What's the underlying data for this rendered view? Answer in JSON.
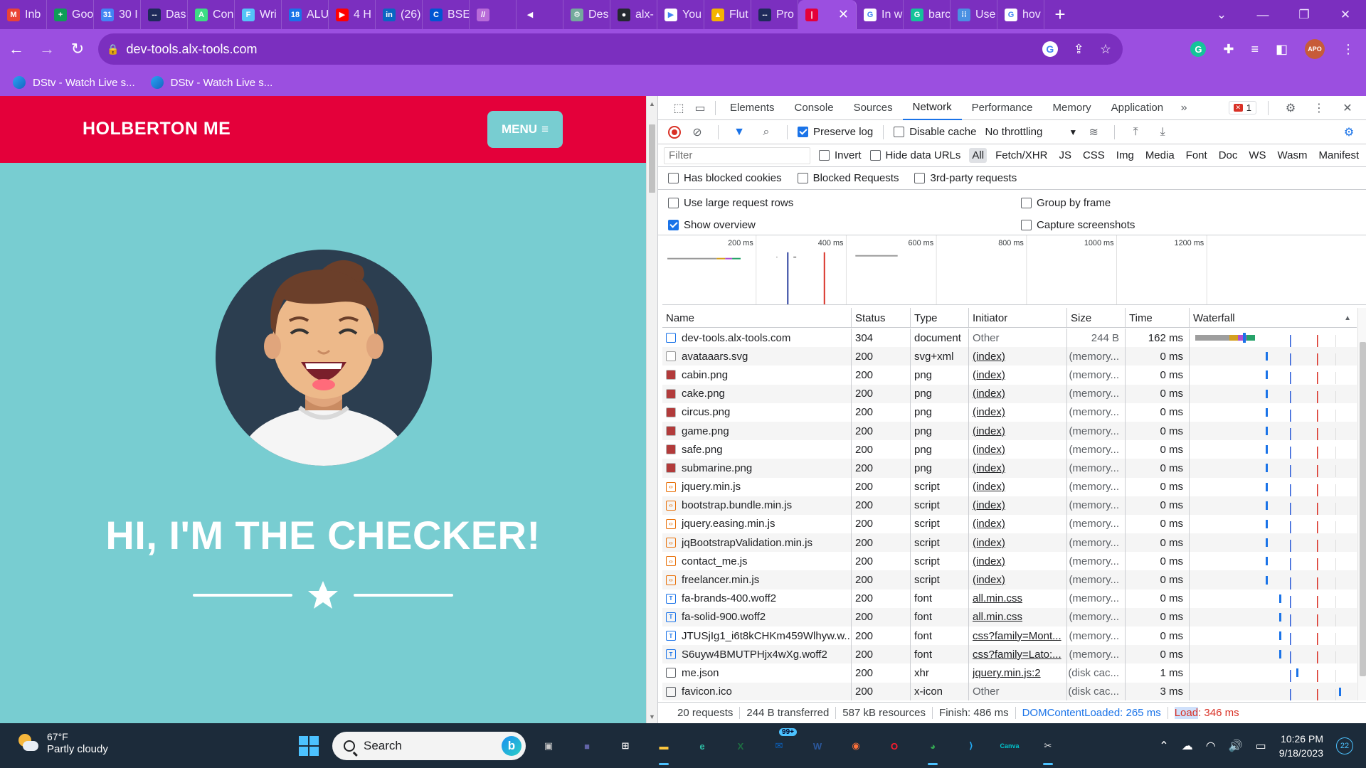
{
  "browser": {
    "tabs": [
      {
        "label": "Inb",
        "icon": "gmail-icon",
        "color": "#ea4335",
        "glyph": "M"
      },
      {
        "label": "Goo",
        "icon": "google-sheets-icon",
        "color": "#0f9d58",
        "glyph": "+"
      },
      {
        "label": "30 I",
        "icon": "google-calendar-icon",
        "color": "#4285f4",
        "glyph": "31"
      },
      {
        "label": "Das",
        "icon": "alx-icon",
        "color": "#1e2a5a",
        "glyph": "--"
      },
      {
        "label": "Con",
        "icon": "android-icon",
        "color": "#3ddc84",
        "glyph": "A"
      },
      {
        "label": "Wri",
        "icon": "flutter-icon",
        "color": "#54c5f8",
        "glyph": "F"
      },
      {
        "label": "ALU",
        "icon": "calendar-icon",
        "color": "#1a73e8",
        "glyph": "18"
      },
      {
        "label": "4 H",
        "icon": "youtube-icon",
        "color": "#ff0000",
        "glyph": "▶"
      },
      {
        "label": "(26)",
        "icon": "linkedin-icon",
        "color": "#0a66c2",
        "glyph": "in"
      },
      {
        "label": "BSE",
        "icon": "coursera-icon",
        "color": "#0056d2",
        "glyph": "C"
      },
      {
        "label": "",
        "icon": "stripes-icon",
        "color": "#b86bd8",
        "glyph": "//"
      },
      {
        "label": "",
        "icon": "muted-audio-icon",
        "color": "#7b2fbf",
        "glyph": "◀"
      },
      {
        "label": "Des",
        "icon": "chatgpt-icon",
        "color": "#74aa9c",
        "glyph": "⚙"
      },
      {
        "label": "alx-",
        "icon": "github-icon",
        "color": "#24292f",
        "glyph": "●"
      },
      {
        "label": "You",
        "icon": "youtube-play-icon",
        "color": "#ffffff",
        "glyph": "▶"
      },
      {
        "label": "Flut",
        "icon": "google-drive-icon",
        "color": "#f4b400",
        "glyph": "▲"
      },
      {
        "label": "Pro",
        "icon": "alx-icon",
        "color": "#1e2a5a",
        "glyph": "--"
      },
      {
        "label": "",
        "icon": "holberton-icon",
        "color": "#e4003a",
        "glyph": "|",
        "active": true
      },
      {
        "label": "In w",
        "icon": "google-icon",
        "color": "#ffffff",
        "glyph": "G"
      },
      {
        "label": "barc",
        "icon": "grammarly-icon",
        "color": "#15c39a",
        "glyph": "G"
      },
      {
        "label": "Use",
        "icon": "grid-dots-icon",
        "color": "#4a90e2",
        "glyph": "⁞⁞"
      },
      {
        "label": "hov",
        "icon": "google-icon",
        "color": "#ffffff",
        "glyph": "G"
      }
    ],
    "url": "dev-tools.alx-tools.com",
    "bookmarks": [
      "DStv - Watch Live s...",
      "DStv - Watch Live s..."
    ],
    "colors": {
      "frame": "#7b2fbf",
      "toolbar": "#9b4fe0"
    }
  },
  "page": {
    "brand": "HOLBERTON ME",
    "menu_label": "MENU",
    "hero_title": "HI, I'M THE CHECKER!",
    "colors": {
      "nav": "#e4003a",
      "hero": "#78cdd1"
    }
  },
  "devtools": {
    "tabs": [
      "Elements",
      "Console",
      "Sources",
      "Network",
      "Performance",
      "Memory",
      "Application"
    ],
    "active_tab": "Network",
    "error_count": "1",
    "toolbar": {
      "preserve_log": "Preserve log",
      "disable_cache": "Disable cache",
      "throttling": "No throttling"
    },
    "filter": {
      "placeholder": "Filter",
      "invert": "Invert",
      "hide_data_urls": "Hide data URLs",
      "types": [
        "All",
        "Fetch/XHR",
        "JS",
        "CSS",
        "Img",
        "Media",
        "Font",
        "Doc",
        "WS",
        "Wasm",
        "Manifest",
        "Other"
      ],
      "has_blocked_cookies": "Has blocked cookies",
      "blocked_requests": "Blocked Requests",
      "third_party": "3rd-party requests"
    },
    "settings": {
      "large_rows": "Use large request rows",
      "show_overview": "Show overview",
      "group_by_frame": "Group by frame",
      "capture_screenshots": "Capture screenshots"
    },
    "overview_ticks": [
      "200 ms",
      "400 ms",
      "600 ms",
      "800 ms",
      "1000 ms",
      "1200 ms"
    ],
    "columns": [
      "Name",
      "Status",
      "Type",
      "Initiator",
      "Size",
      "Time",
      "Waterfall"
    ],
    "requests": [
      {
        "name": "dev-tools.alx-tools.com",
        "status": "304",
        "type": "document",
        "initiator": "Other",
        "size": "244 B",
        "time": "162 ms",
        "kind": "document"
      },
      {
        "name": "avataaars.svg",
        "status": "200",
        "type": "svg+xml",
        "initiator": "(index)",
        "size": "(memory...",
        "time": "0 ms",
        "kind": "svg"
      },
      {
        "name": "cabin.png",
        "status": "200",
        "type": "png",
        "initiator": "(index)",
        "size": "(memory...",
        "time": "0 ms",
        "kind": "png"
      },
      {
        "name": "cake.png",
        "status": "200",
        "type": "png",
        "initiator": "(index)",
        "size": "(memory...",
        "time": "0 ms",
        "kind": "png"
      },
      {
        "name": "circus.png",
        "status": "200",
        "type": "png",
        "initiator": "(index)",
        "size": "(memory...",
        "time": "0 ms",
        "kind": "png"
      },
      {
        "name": "game.png",
        "status": "200",
        "type": "png",
        "initiator": "(index)",
        "size": "(memory...",
        "time": "0 ms",
        "kind": "png"
      },
      {
        "name": "safe.png",
        "status": "200",
        "type": "png",
        "initiator": "(index)",
        "size": "(memory...",
        "time": "0 ms",
        "kind": "png"
      },
      {
        "name": "submarine.png",
        "status": "200",
        "type": "png",
        "initiator": "(index)",
        "size": "(memory...",
        "time": "0 ms",
        "kind": "png"
      },
      {
        "name": "jquery.min.js",
        "status": "200",
        "type": "script",
        "initiator": "(index)",
        "size": "(memory...",
        "time": "0 ms",
        "kind": "script"
      },
      {
        "name": "bootstrap.bundle.min.js",
        "status": "200",
        "type": "script",
        "initiator": "(index)",
        "size": "(memory...",
        "time": "0 ms",
        "kind": "script"
      },
      {
        "name": "jquery.easing.min.js",
        "status": "200",
        "type": "script",
        "initiator": "(index)",
        "size": "(memory...",
        "time": "0 ms",
        "kind": "script"
      },
      {
        "name": "jqBootstrapValidation.min.js",
        "status": "200",
        "type": "script",
        "initiator": "(index)",
        "size": "(memory...",
        "time": "0 ms",
        "kind": "script"
      },
      {
        "name": "contact_me.js",
        "status": "200",
        "type": "script",
        "initiator": "(index)",
        "size": "(memory...",
        "time": "0 ms",
        "kind": "script"
      },
      {
        "name": "freelancer.min.js",
        "status": "200",
        "type": "script",
        "initiator": "(index)",
        "size": "(memory...",
        "time": "0 ms",
        "kind": "script"
      },
      {
        "name": "fa-brands-400.woff2",
        "status": "200",
        "type": "font",
        "initiator": "all.min.css",
        "size": "(memory...",
        "time": "0 ms",
        "kind": "font"
      },
      {
        "name": "fa-solid-900.woff2",
        "status": "200",
        "type": "font",
        "initiator": "all.min.css",
        "size": "(memory...",
        "time": "0 ms",
        "kind": "font"
      },
      {
        "name": "JTUSjIg1_i6t8kCHKm459Wlhyw.w...",
        "status": "200",
        "type": "font",
        "initiator": "css?family=Mont...",
        "size": "(memory...",
        "time": "0 ms",
        "kind": "font"
      },
      {
        "name": "S6uyw4BMUTPHjx4wXg.woff2",
        "status": "200",
        "type": "font",
        "initiator": "css?family=Lato:...",
        "size": "(memory...",
        "time": "0 ms",
        "kind": "font"
      },
      {
        "name": "me.json",
        "status": "200",
        "type": "xhr",
        "initiator": "jquery.min.js:2",
        "size": "(disk cac...",
        "time": "1 ms",
        "kind": "xhr"
      },
      {
        "name": "favicon.ico",
        "status": "200",
        "type": "x-icon",
        "initiator": "Other",
        "size": "(disk cac...",
        "time": "3 ms",
        "kind": "icon"
      }
    ],
    "status_bar": {
      "requests": "20 requests",
      "transferred": "244 B transferred",
      "resources": "587 kB resources",
      "finish": "Finish: 486 ms",
      "dcl": "DOMContentLoaded: 265 ms",
      "load_label": "Load",
      "load_value": ": 346 ms"
    }
  },
  "taskbar": {
    "temperature": "67°F",
    "condition": "Partly cloudy",
    "search_label": "Search",
    "apps": [
      {
        "name": "task-view-icon",
        "glyph": "▣",
        "color": "#c9c9c9"
      },
      {
        "name": "teams-icon",
        "glyph": "■",
        "color": "#6264a7"
      },
      {
        "name": "store-icon",
        "glyph": "⊞",
        "color": "#f3f3f3"
      },
      {
        "name": "file-explorer-icon",
        "glyph": "▬",
        "color": "#ffc83d",
        "active": true
      },
      {
        "name": "edge-icon",
        "glyph": "e",
        "color": "#2ebea6"
      },
      {
        "name": "excel-icon",
        "glyph": "X",
        "color": "#1d6f42"
      },
      {
        "name": "mail-icon",
        "glyph": "✉",
        "color": "#0a64c2",
        "badge": "99+"
      },
      {
        "name": "word-icon",
        "glyph": "W",
        "color": "#2b579a"
      },
      {
        "name": "firefox-icon",
        "glyph": "◉",
        "color": "#ff7139"
      },
      {
        "name": "opera-icon",
        "glyph": "O",
        "color": "#ff1b2d"
      },
      {
        "name": "chrome-icon",
        "glyph": "◕",
        "color": "#34a853",
        "active": true
      },
      {
        "name": "vscode-icon",
        "glyph": "⟩",
        "color": "#23a9f2"
      },
      {
        "name": "canva-icon",
        "glyph": "Canva",
        "color": "#00c4cc"
      },
      {
        "name": "snipping-tool-icon",
        "glyph": "✂",
        "color": "#e8e8e8",
        "active": true
      }
    ],
    "time": "10:26 PM",
    "date": "9/18/2023",
    "notifications": "22"
  }
}
